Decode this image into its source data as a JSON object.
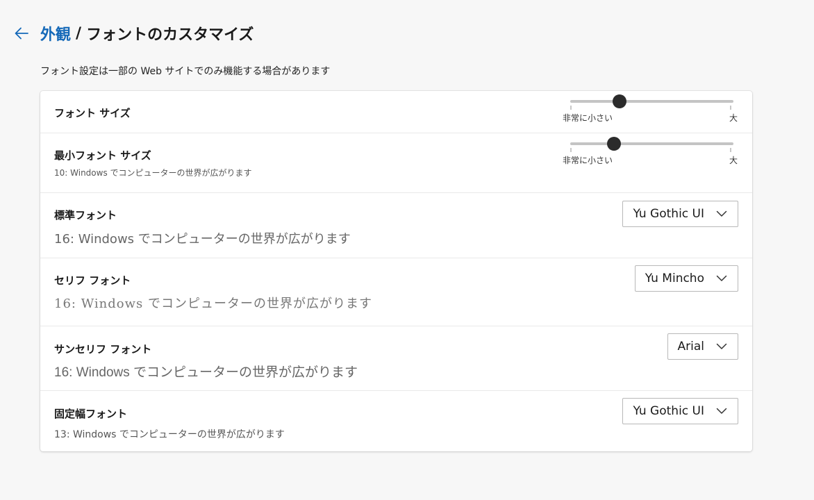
{
  "header": {
    "back_icon": "arrow-left-icon",
    "breadcrumb_parent": "外観",
    "separator": "/",
    "breadcrumb_current": "フォントのカスタマイズ"
  },
  "note": "フォント設定は一部の Web サイトでのみ機能する場合があります",
  "font_size": {
    "label": "フォント サイズ",
    "min_label": "非常に小さい",
    "max_label": "大",
    "level": 0.3
  },
  "min_font_size": {
    "label": "最小フォント サイズ",
    "preview": "10: Windows でコンピューターの世界が広がります",
    "min_label": "非常に小さい",
    "max_label": "大",
    "level": 0.27
  },
  "standard_font": {
    "label": "標準フォント",
    "preview": "16: Windows でコンピューターの世界が広がります",
    "selected": "Yu Gothic UI"
  },
  "serif_font": {
    "label": "セリフ フォント",
    "preview": "16: Windows でコンピューターの世界が広がります",
    "selected": "Yu Mincho"
  },
  "sans_serif_font": {
    "label": "サンセリフ フォント",
    "preview": "16: Windows でコンピューターの世界が広がります",
    "selected": "Arial"
  },
  "fixed_width_font": {
    "label": "固定幅フォント",
    "preview": "13: Windows でコンピューターの世界が広がります",
    "selected": "Yu Gothic UI"
  },
  "colors": {
    "accent": "#1569b8",
    "thumb": "#2b2b2b",
    "track": "#c4c4c4"
  },
  "icons": {
    "dropdown": "chevron-down-icon"
  }
}
